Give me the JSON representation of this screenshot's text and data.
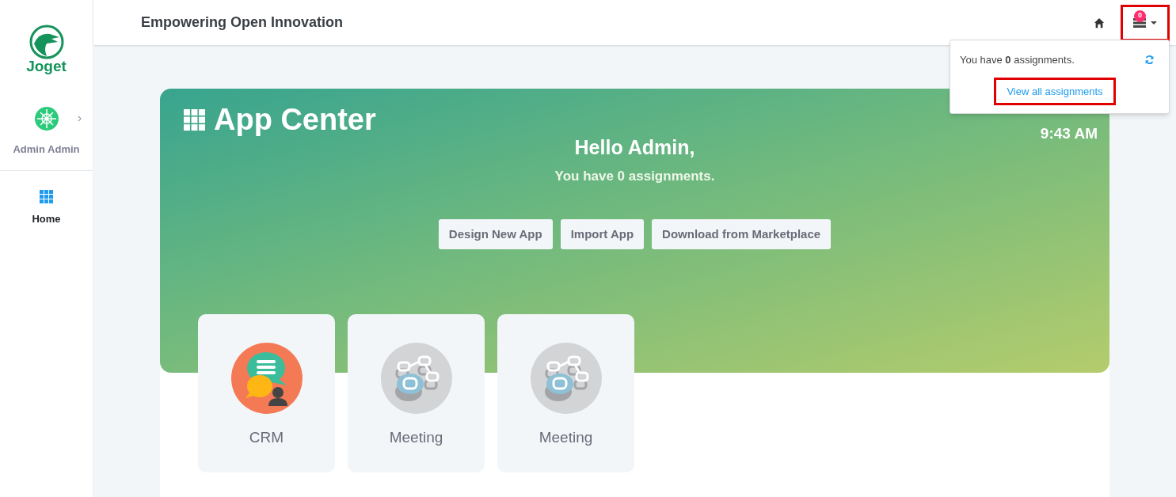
{
  "sidebar": {
    "brand": "Joget",
    "user": {
      "name": "Admin Admin"
    },
    "items": [
      {
        "label": "Home",
        "selected": true
      }
    ]
  },
  "header": {
    "title": "Empowering Open Innovation",
    "badge": "0",
    "highlighted": true
  },
  "dropdown": {
    "message": "You have **0** assignments.",
    "link": "View all assignments",
    "link_highlighted": true
  },
  "banner": {
    "title": "App Center",
    "time": "9:43 AM",
    "greeting": "Hello Admin,",
    "subtitle": "You have 0 assignments.",
    "buttons": [
      "Design New App",
      "Import App",
      "Download from Marketplace"
    ]
  },
  "apps": [
    {
      "name": "CRM",
      "kind": "crm"
    },
    {
      "name": "Meeting",
      "kind": "process"
    },
    {
      "name": "Meeting",
      "kind": "process"
    }
  ]
}
